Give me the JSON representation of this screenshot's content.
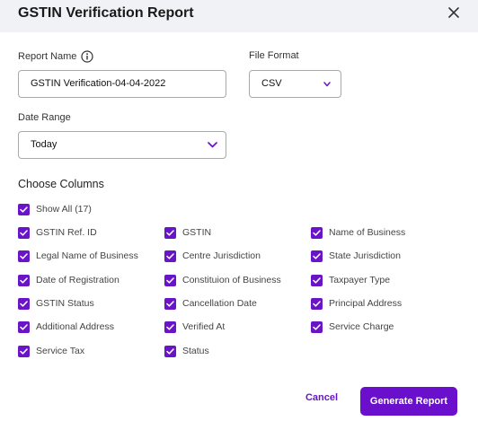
{
  "dialog": {
    "title": "GSTIN Verification Report"
  },
  "form": {
    "report_name_label": "Report Name",
    "report_name_value": "GSTIN Verification-04-04-2022",
    "file_format_label": "File Format",
    "file_format_value": "CSV",
    "date_range_label": "Date Range",
    "date_range_value": "Today"
  },
  "columns": {
    "title": "Choose Columns",
    "show_all": "Show All (17)",
    "items": [
      "GSTIN Ref. ID",
      "GSTIN",
      "Name of Business",
      "Legal Name of Business",
      "Centre Jurisdiction",
      "State Jurisdiction",
      "Date of Registration",
      "Constituion of Business",
      "Taxpayer Type",
      "GSTIN Status",
      "Cancellation Date",
      "Principal Address",
      "Additional Address",
      "Verified At",
      "Service Charge",
      "Service Tax",
      "Status"
    ]
  },
  "actions": {
    "cancel": "Cancel",
    "generate": "Generate Report"
  },
  "colors": {
    "accent": "#6a14c8",
    "header_bg": "#f1f2f6"
  },
  "icons": {
    "close": "close-icon",
    "info": "info-icon",
    "chevron": "chevron-down-icon",
    "check": "check-icon"
  }
}
